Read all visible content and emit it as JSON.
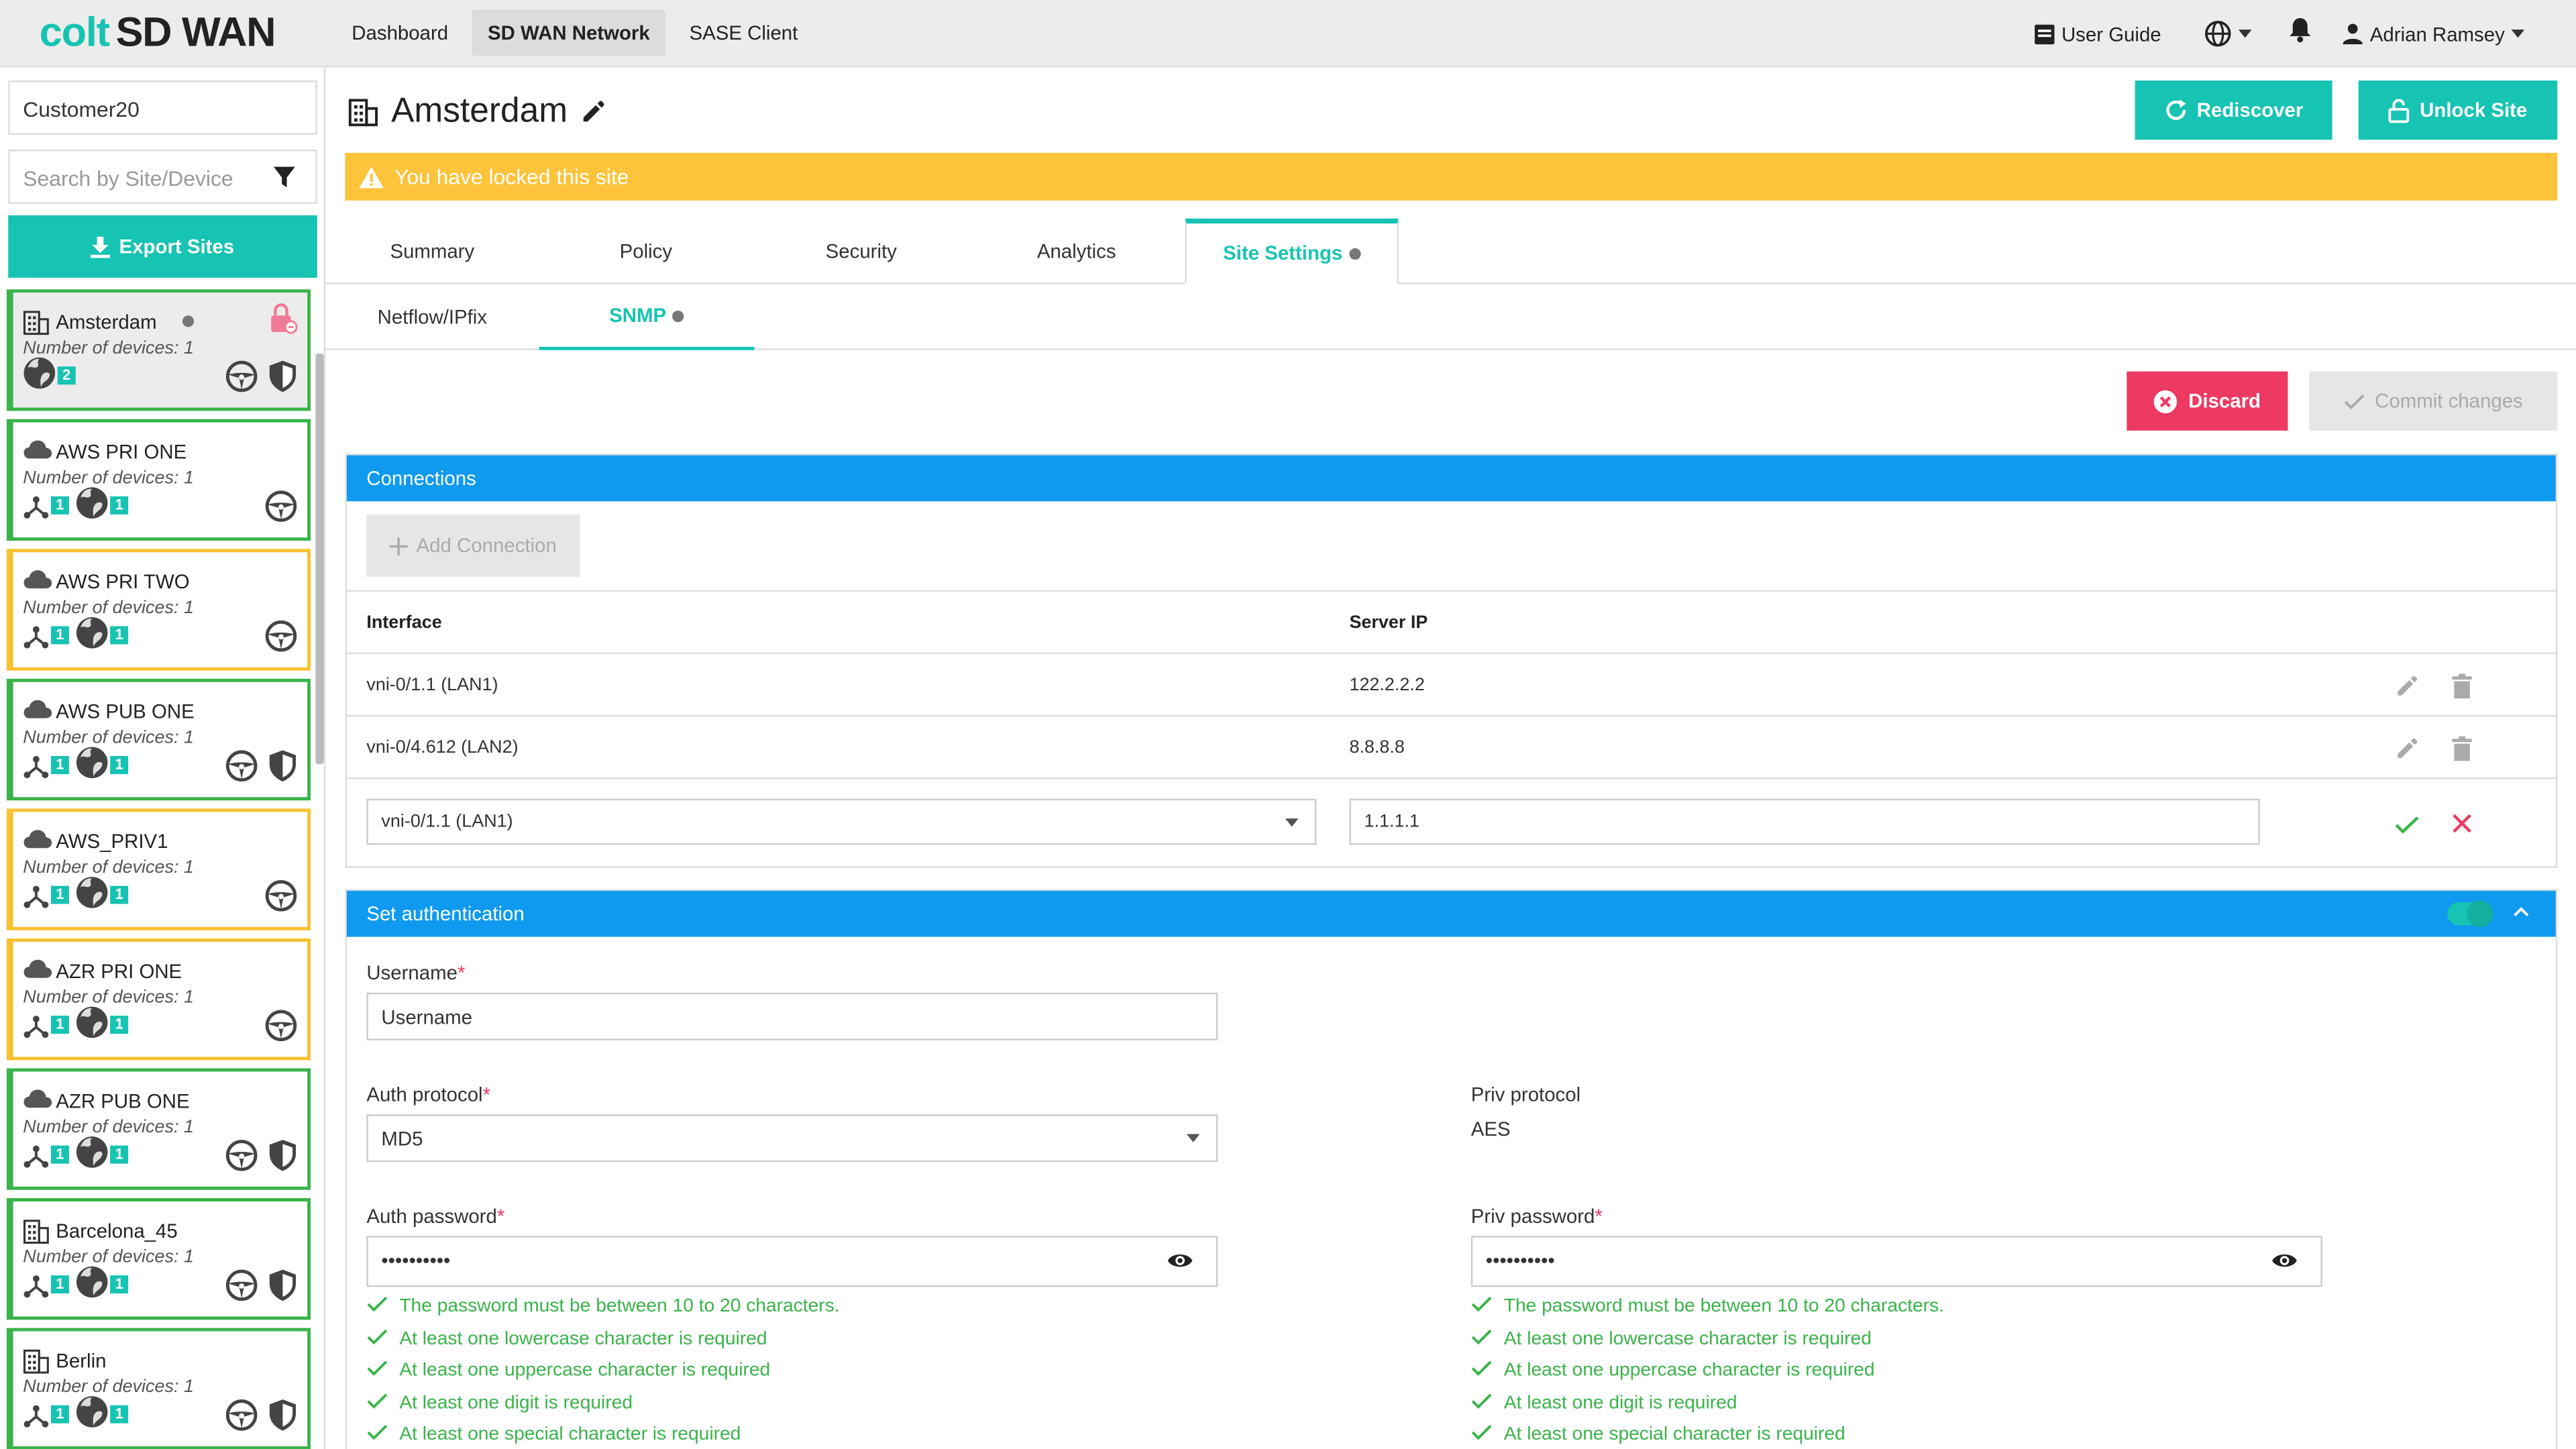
{
  "brand": {
    "part1": "colt",
    "part2": "SD WAN"
  },
  "nav": {
    "items": [
      "Dashboard",
      "SD WAN Network",
      "SASE Client"
    ],
    "active": "SD WAN Network"
  },
  "topright": {
    "user_guide": "User Guide",
    "user": "Adrian Ramsey"
  },
  "sidebar": {
    "customer": "Customer20",
    "search_placeholder": "Search by Site/Device",
    "export_label": "Export Sites",
    "sites": [
      {
        "name": "Amsterdam",
        "devices": "Number of devices: 1",
        "type": "building",
        "status": "green",
        "badges": [
          "2"
        ],
        "icons": [
          "globe"
        ],
        "right_icons": [
          "wheel",
          "shield"
        ],
        "selected": true,
        "locked": true
      },
      {
        "name": "AWS PRI ONE",
        "devices": "Number of devices: 1",
        "type": "cloud",
        "status": "green",
        "badges": [
          "1",
          "1"
        ],
        "icons": [
          "fork",
          "globe"
        ],
        "right_icons": [
          "wheel"
        ]
      },
      {
        "name": "AWS PRI TWO",
        "devices": "Number of devices: 1",
        "type": "cloud",
        "status": "yellow",
        "badges": [
          "1",
          "1"
        ],
        "icons": [
          "fork",
          "globe"
        ],
        "right_icons": [
          "wheel"
        ]
      },
      {
        "name": "AWS PUB ONE",
        "devices": "Number of devices: 1",
        "type": "cloud",
        "status": "green",
        "badges": [
          "1",
          "1"
        ],
        "icons": [
          "fork",
          "globe"
        ],
        "right_icons": [
          "wheel",
          "shield"
        ]
      },
      {
        "name": "AWS_PRIV1",
        "devices": "Number of devices: 1",
        "type": "cloud",
        "status": "yellow",
        "badges": [
          "1",
          "1"
        ],
        "icons": [
          "fork",
          "globe"
        ],
        "right_icons": [
          "wheel"
        ]
      },
      {
        "name": "AZR PRI ONE",
        "devices": "Number of devices: 1",
        "type": "cloud",
        "status": "yellow",
        "badges": [
          "1",
          "1"
        ],
        "icons": [
          "fork",
          "globe"
        ],
        "right_icons": [
          "wheel"
        ]
      },
      {
        "name": "AZR PUB ONE",
        "devices": "Number of devices: 1",
        "type": "cloud",
        "status": "green",
        "badges": [
          "1",
          "1"
        ],
        "icons": [
          "fork",
          "globe"
        ],
        "right_icons": [
          "wheel",
          "shield"
        ]
      },
      {
        "name": "Barcelona_45",
        "devices": "Number of devices: 1",
        "type": "building",
        "status": "green",
        "badges": [
          "1",
          "1"
        ],
        "icons": [
          "fork",
          "globe"
        ],
        "right_icons": [
          "wheel",
          "shield"
        ]
      },
      {
        "name": "Berlin",
        "devices": "Number of devices: 1",
        "type": "building",
        "status": "green",
        "badges": [
          "1",
          "1"
        ],
        "icons": [
          "fork",
          "globe"
        ],
        "right_icons": [
          "wheel",
          "shield"
        ]
      }
    ]
  },
  "page": {
    "title": "Amsterdam",
    "rediscover": "Rediscover",
    "unlock": "Unlock Site",
    "warning": "You have locked this site",
    "tabs": [
      "Summary",
      "Policy",
      "Security",
      "Analytics",
      "Site Settings"
    ],
    "active_tab": "Site Settings",
    "subtabs": [
      "Netflow/IPfix",
      "SNMP"
    ],
    "active_subtab": "SNMP",
    "discard": "Discard",
    "commit": "Commit changes"
  },
  "connections": {
    "header": "Connections",
    "add_label": "Add Connection",
    "col_interface": "Interface",
    "col_server": "Server IP",
    "rows": [
      {
        "interface": "vni-0/1.1 (LAN1)",
        "server": "122.2.2.2"
      },
      {
        "interface": "vni-0/4.612 (LAN2)",
        "server": "8.8.8.8"
      }
    ],
    "edit_row": {
      "interface": "vni-0/1.1 (LAN1)",
      "server": "1.1.1.1"
    }
  },
  "auth": {
    "header": "Set authentication",
    "enabled": true,
    "username_label": "Username",
    "username_value": "Username",
    "auth_protocol_label": "Auth protocol",
    "auth_protocol_value": "MD5",
    "priv_protocol_label": "Priv protocol",
    "priv_protocol_value": "AES",
    "auth_password_label": "Auth password",
    "auth_password_value": "••••••••••",
    "priv_password_label": "Priv password",
    "priv_password_value": "••••••••••",
    "rules": [
      "The password must be between 10 to 20 characters.",
      "At least one lowercase character is required",
      "At least one uppercase character is required",
      "At least one digit is required",
      "At least one special character is required"
    ]
  },
  "colors": {
    "accent": "#17c3b2",
    "blue": "#0f9af0",
    "warning": "#fcc33b",
    "danger": "#ec3a63",
    "ok": "#3ab34a"
  }
}
